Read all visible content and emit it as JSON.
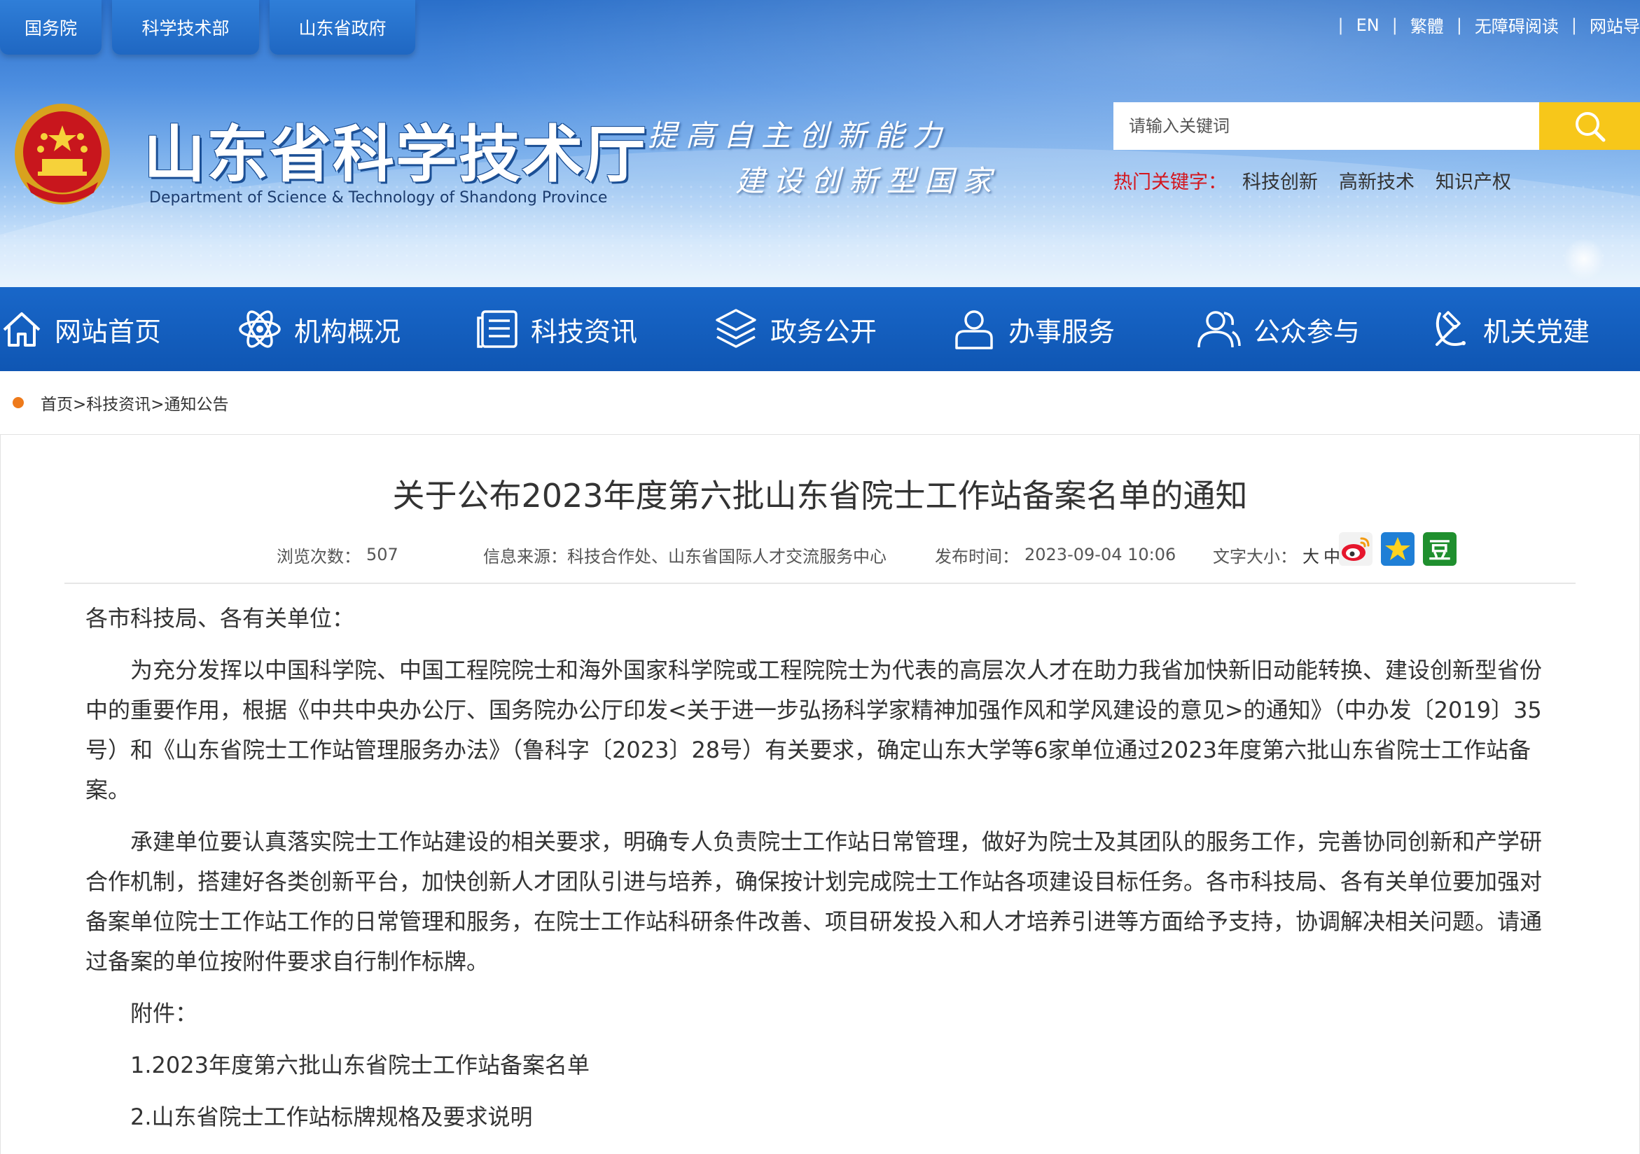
{
  "top_tabs": [
    "国务院",
    "科学技术部",
    "山东省政府"
  ],
  "top_links": [
    "EN",
    "繁體",
    "无障碍阅读",
    "网站导"
  ],
  "site": {
    "title": "山东省科学技术厅",
    "subtitle": "Department of Science & Technology of Shandong Province",
    "slogan_line1": "提高自主创新能力",
    "slogan_line2": "建设创新型国家"
  },
  "search": {
    "placeholder": "请输入关键词",
    "hot_label": "热门关键字：",
    "hot_keywords": [
      "科技创新",
      "高新技术",
      "知识产权"
    ]
  },
  "nav": [
    "网站首页",
    "机构概况",
    "科技资讯",
    "政务公开",
    "办事服务",
    "公众参与",
    "机关党建"
  ],
  "breadcrumb": "首页>科技资讯>通知公告",
  "article": {
    "title": "关于公布2023年度第六批山东省院士工作站备案名单的通知",
    "views_label": "浏览次数：",
    "views": "507",
    "source_label": "信息来源：",
    "source": "科技合作处、山东省国际人才交流服务中心",
    "time_label": "发布时间：",
    "time": "2023-09-04 10:06",
    "font_label": "文字大小：",
    "font_large": "大",
    "font_medium": "中",
    "share_douban": "豆",
    "greeting": "各市科技局、各有关单位：",
    "para1": "为充分发挥以中国科学院、中国工程院院士和海外国家科学院或工程院院士为代表的高层次人才在助力我省加快新旧动能转换、建设创新型省份中的重要作用，根据《中共中央办公厅、国务院办公厅印发<关于进一步弘扬科学家精神加强作风和学风建设的意见>的通知》（中办发〔2019〕35号）和《山东省院士工作站管理服务办法》（鲁科字〔2023〕28号）有关要求，确定山东大学等6家单位通过2023年度第六批山东省院士工作站备案。",
    "para2": "承建单位要认真落实院士工作站建设的相关要求，明确专人负责院士工作站日常管理，做好为院士及其团队的服务工作，完善协同创新和产学研合作机制，搭建好各类创新平台，加快创新人才团队引进与培养，确保按计划完成院士工作站各项建设目标任务。各市科技局、各有关单位要加强对备案单位院士工作站工作的日常管理和服务，在院士工作站科研条件改善、项目研发投入和人才培养引进等方面给予支持，协调解决相关问题。请通过备案的单位按附件要求自行制作标牌。",
    "attach_label": "附件：",
    "attach1": "1.2023年度第六批山东省院士工作站备案名单",
    "attach2": "2.山东省院士工作站标牌规格及要求说明"
  },
  "colors": {
    "nav_bg": "#1562c4",
    "search_btn": "#f7c71a",
    "hot_label": "#d4161d",
    "crumb_dot": "#ee7a1b"
  }
}
